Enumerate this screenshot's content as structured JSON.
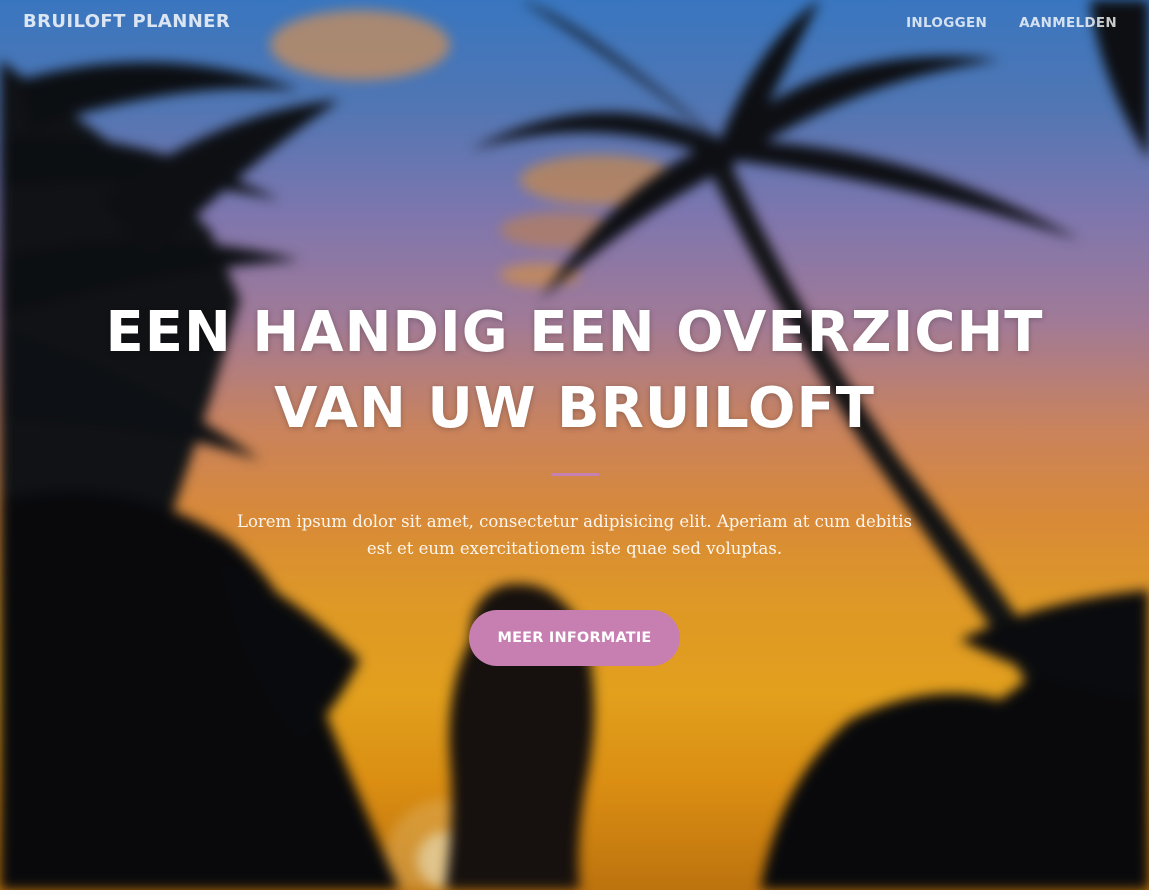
{
  "navbar": {
    "brand": "BRUILOFT PLANNER",
    "links": [
      {
        "label": "INLOGGEN"
      },
      {
        "label": "AANMELDEN"
      }
    ]
  },
  "masthead": {
    "headline_line1": "EEN HANDIG EEN OVERZICHT",
    "headline_line2": "VAN UW BRUILOFT",
    "lead_line1": "Lorem ipsum dolor sit amet, consectetur adipisicing elit. Aperiam at cum debitis",
    "lead_line2": "est et eum exercitationem iste quae sed voluptas.",
    "cta_label": "MEER INFORMATIE"
  },
  "colors": {
    "accent": "#c77fb1",
    "divider": "#c681b3",
    "text": "#ffffff"
  }
}
